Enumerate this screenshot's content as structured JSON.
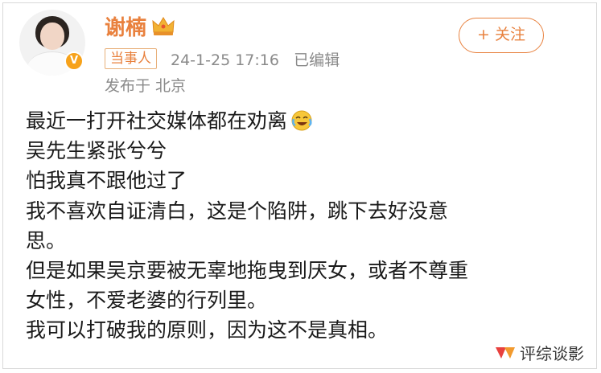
{
  "post": {
    "author": "谢楠",
    "badge": "当事人",
    "meta": "24-1-25 17:16   已编辑",
    "location": "发布于 北京",
    "follow_label": "+ 关注",
    "lines": [
      "最近一打开社交媒体都在劝离",
      "吴先生紧张兮兮",
      "怕我真不跟他过了",
      "我不喜欢自证清白，这是个陷阱，跳下去好没意",
      "思。",
      "但是如果吴京要被无辜地拖曳到厌女，或者不尊重",
      "女性，不爱老婆的行列里。",
      "我可以打破我的原则，因为这不是真相。"
    ],
    "verified_mark": "V"
  },
  "watermark": "评综谈影",
  "colors": {
    "accent": "#e8813e",
    "meta": "#8a8a8a",
    "text": "#1a1a1a"
  },
  "icons": {
    "crown": "crown-icon",
    "emoji": "laughing-crying-emoji-icon",
    "verified": "verified-v-icon"
  }
}
